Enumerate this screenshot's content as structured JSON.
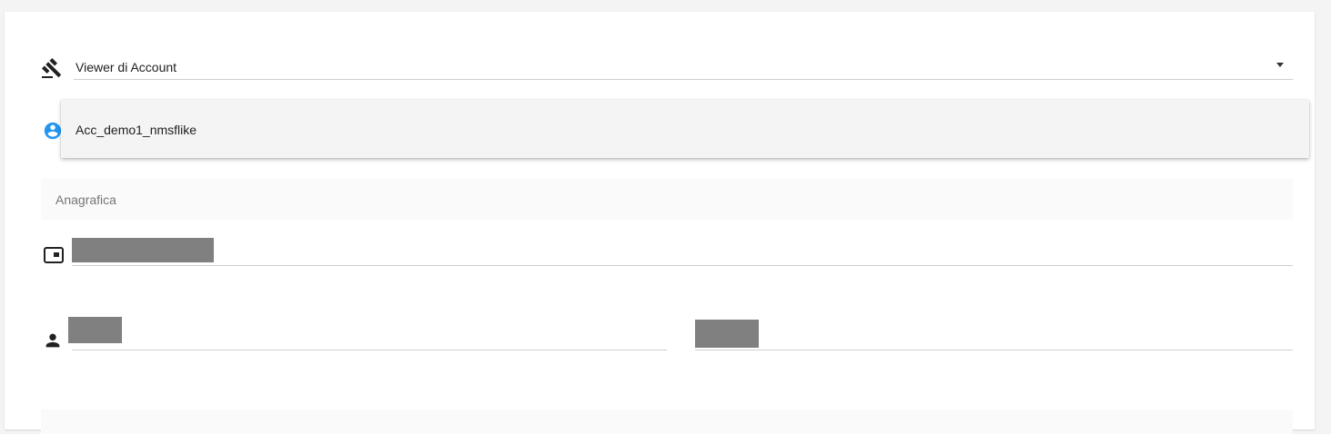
{
  "role_select": {
    "value": "Viewer di Account",
    "icon": "gavel-icon"
  },
  "account_menu": {
    "icon": "account-circle-icon",
    "icon_color": "#2196f3",
    "items": [
      {
        "label": "Acc_demo1_nmsflike"
      }
    ]
  },
  "section": {
    "title": "Anagrafica"
  },
  "fields": {
    "card_icon": "id-card-icon",
    "person_icon": "person-icon",
    "redaction_color": "#808080"
  }
}
